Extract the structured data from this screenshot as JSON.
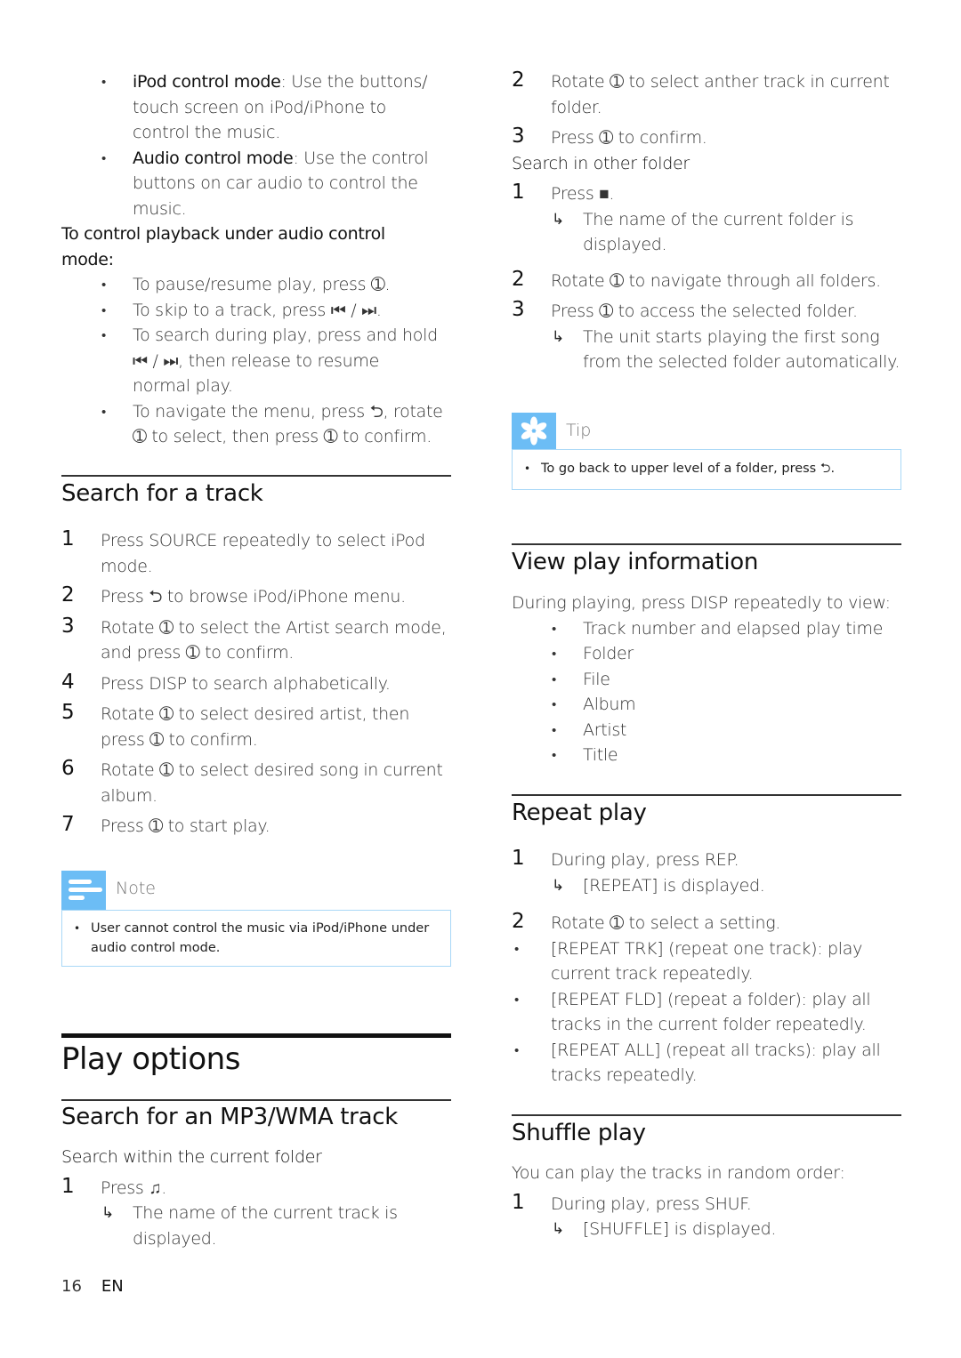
{
  "left": {
    "mode_bullets": [
      {
        "term": "iPod control mode",
        "lines": [
          ": Use the buttons/",
          "touch screen on iPod/iPhone to",
          "control the music."
        ]
      },
      {
        "term": "Audio control mode",
        "lines": [
          ": Use the control",
          "buttons on car audio to control the",
          "music."
        ]
      }
    ],
    "playback_intro": [
      "To control playback under audio control",
      "mode:"
    ],
    "playback_bullets": [
      {
        "lines": [
          "To pause/resume play, press ➀."
        ]
      },
      {
        "lines": [
          "To skip to a track, press ⏮ / ⏭."
        ]
      },
      {
        "lines": [
          "To search during play, press and hold",
          "⏮ / ⏭, then release to resume",
          "normal play."
        ]
      },
      {
        "lines": [
          "To navigate the menu, press ⮌, rotate",
          "➀ to select, then press ➀ to confirm."
        ]
      }
    ],
    "search_track": {
      "heading": "Search for a track",
      "steps": [
        {
          "num": "1",
          "lines": [
            "Press SOURCE repeatedly to select iPod",
            "mode."
          ]
        },
        {
          "num": "2",
          "lines": [
            "Press ⮌ to browse iPod/iPhone menu."
          ]
        },
        {
          "num": "3",
          "lines": [
            "Rotate ➀ to select the Artist search mode,",
            "and press ➀ to confirm."
          ]
        },
        {
          "num": "4",
          "lines": [
            "Press DISP to search alphabetically."
          ]
        },
        {
          "num": "5",
          "lines": [
            "Rotate ➀ to select desired artist, then",
            "press ➀ to confirm."
          ]
        },
        {
          "num": "6",
          "lines": [
            "Rotate ➀ to select desired song in current",
            "album."
          ]
        },
        {
          "num": "7",
          "lines": [
            "Press ➀ to start play."
          ]
        }
      ]
    },
    "note": {
      "title": "Note",
      "icon": "note-lines-icon",
      "lines": [
        "User cannot control the music via iPod/iPhone under",
        "audio control mode."
      ]
    },
    "play_options": {
      "title": "Play options",
      "mp3_heading": "Search for an MP3/WMA track",
      "subheading": "Search within the current folder",
      "step1": "Press ♫.",
      "step1_result": [
        "The name of the current track is",
        "displayed."
      ]
    }
  },
  "right": {
    "current_folder_steps": [
      {
        "num": "2",
        "lines": [
          "Rotate ➀ to select anther track in current",
          "folder."
        ]
      },
      {
        "num": "3",
        "lines": [
          "Press ➀ to confirm."
        ]
      }
    ],
    "other_folder": {
      "subheading": "Search in other folder",
      "step1": "Press ■.",
      "step1_result": [
        "The name of the current folder is",
        "displayed."
      ],
      "step2": "Rotate ➀ to navigate through all folders.",
      "step3": "Press ➀ to access the selected folder.",
      "step3_result": [
        "The unit starts playing the first song",
        "from the selected folder automatically."
      ]
    },
    "tip": {
      "title": "Tip",
      "icon": "asterisk-tip-icon",
      "text": "To go back to upper level of a folder, press ⮌."
    },
    "view_info": {
      "heading": "View play information",
      "intro": "During playing, press DISP repeatedly to view:",
      "items": [
        "Track number and elapsed play time",
        "Folder",
        "File",
        "Album",
        "Artist",
        "Title"
      ]
    },
    "repeat": {
      "heading": "Repeat play",
      "step1": "During play, press REP.",
      "step1_result": "[REPEAT] is displayed.",
      "step2": "Rotate ➀ to select a setting.",
      "options": [
        {
          "lines": [
            "[REPEAT TRK] (repeat one track): play",
            "current track repeatedly."
          ]
        },
        {
          "lines": [
            "[REPEAT FLD] (repeat a folder): play all",
            "tracks in the current folder repeatedly."
          ]
        },
        {
          "lines": [
            "[REPEAT ALL] (repeat all tracks): play all",
            "tracks repeatedly."
          ]
        }
      ]
    },
    "shuffle": {
      "heading": "Shuffle play",
      "intro": "You can play the tracks in random order:",
      "step1": "During play, press SHUF.",
      "step1_result": "[SHUFFLE] is displayed."
    }
  },
  "footer": {
    "page_number": "16",
    "language": "EN"
  },
  "colors": {
    "callout_accent": "#6cbdf5",
    "callout_border": "#a9d8f7"
  }
}
